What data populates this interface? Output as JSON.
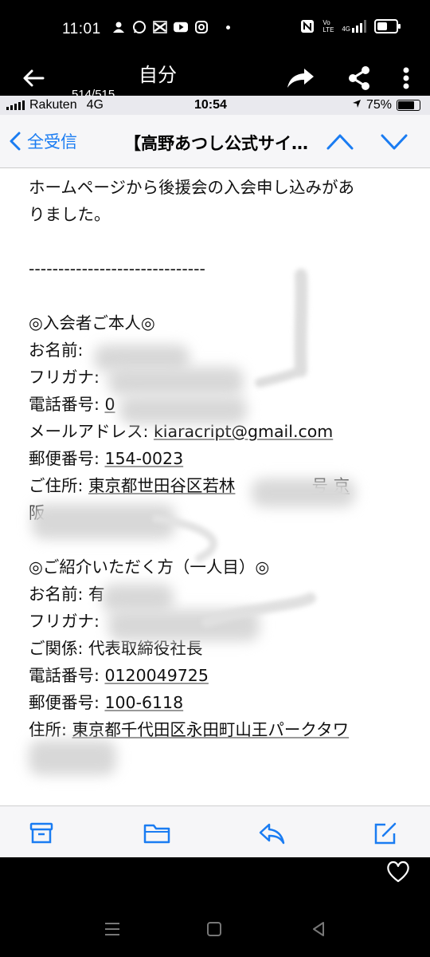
{
  "status_bar": {
    "time": "11:01",
    "app_icons": [
      "person-icon",
      "whatsapp-icon",
      "capcut-icon",
      "youtube-icon",
      "instagram-icon"
    ],
    "network_tag_1": "Vo LTE",
    "network_tag_2": "4G",
    "battery_level": 0.55
  },
  "viewer": {
    "title": "自分",
    "count": "514/515"
  },
  "ios_status": {
    "carrier": "Rakuten",
    "network": "4G",
    "time": "10:54",
    "battery": "75%",
    "battery_level": 0.75
  },
  "mail_nav": {
    "back_label": "全受信",
    "subject": "【高野あつし公式サイ…"
  },
  "body": {
    "line1": "ホームページから後援会の入会申し込みがあ",
    "line2": "りました。",
    "divider": "------------------------------",
    "section1_title": "◎入会者ご本人◎",
    "name_label": "お名前: ",
    "furigana_label": "フリガナ: ",
    "phone_label": "電話番号: ",
    "phone_value": "0",
    "email_label": "メールアドレス: ",
    "email_value": "kiaracript@gmail.com",
    "postal_label": "郵便番号: ",
    "postal_value": "154-0023",
    "address_label": "ご住所: ",
    "address_value_a": "東京都世田谷区若林",
    "address_value_b": "号 京",
    "address_value_c": "阪",
    "section2_title": "◎ご紹介いただく方（一人目）◎",
    "name2_label": "お名前: ",
    "name2_value": "有",
    "furigana2_label": "フリガナ: ",
    "relation_label": "ご関係: ",
    "relation_value": "代表取締役社長",
    "phone2_label": "電話番号: ",
    "phone2_value": "0120049725",
    "postal2_label": "郵便番号: ",
    "postal2_value": "100-6118",
    "address2_label": "住所: ",
    "address2_value": "東京都千代田区永田町山王パークタワ"
  },
  "toolbar": {
    "icons": [
      "archive-icon",
      "folder-icon",
      "reply-icon",
      "compose-icon"
    ]
  },
  "colors": {
    "ios_blue": "#1a7cf2",
    "background_dark": "#000000"
  }
}
